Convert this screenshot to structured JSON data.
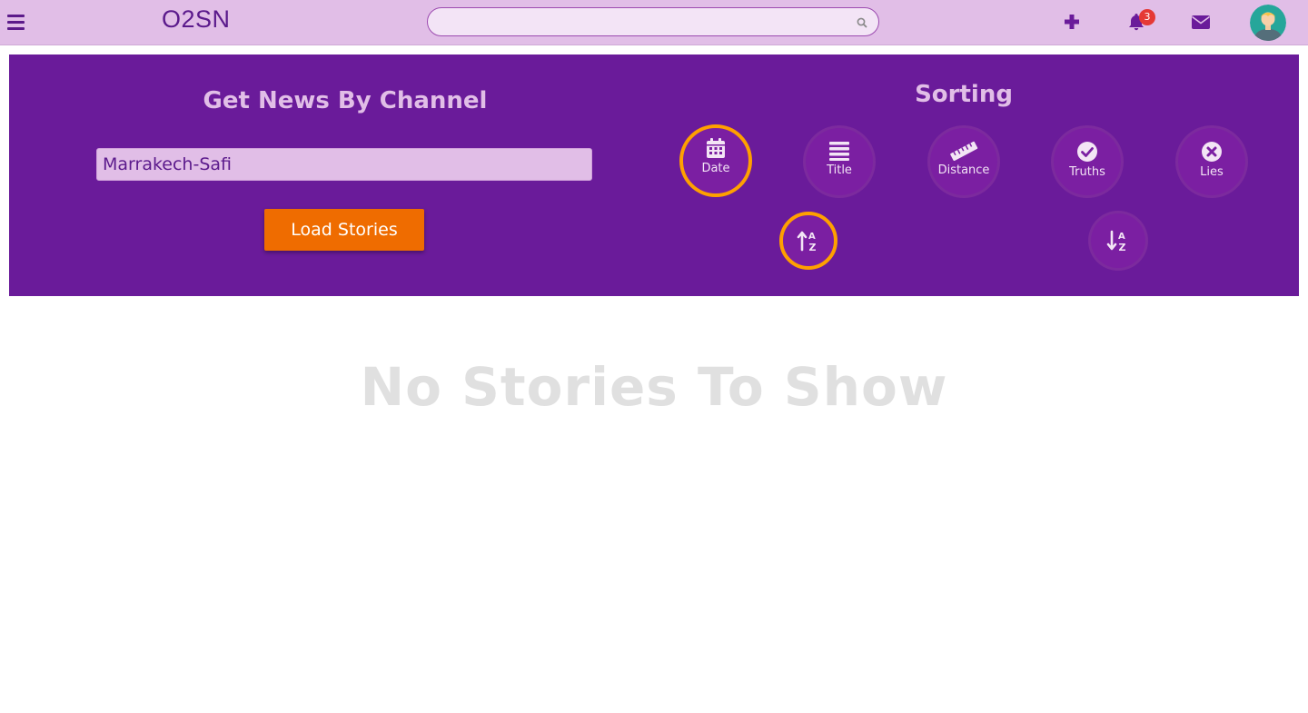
{
  "header": {
    "logo": "O2SN",
    "search": {
      "placeholder": "",
      "value": ""
    },
    "notifications_count": "3",
    "icons": [
      "menu-icon",
      "search-icon",
      "plus-icon",
      "bell-icon",
      "envelope-icon",
      "avatar"
    ]
  },
  "channel_panel": {
    "title": "Get News By Channel",
    "channel_value": "Marrakech-Safi",
    "load_button": "Load Stories"
  },
  "sorting": {
    "title": "Sorting",
    "options": [
      {
        "label": "Date",
        "icon": "calendar-icon",
        "active": true
      },
      {
        "label": "Title",
        "icon": "list-icon",
        "active": false
      },
      {
        "label": "Distance",
        "icon": "ruler-icon",
        "active": false
      },
      {
        "label": "Truths",
        "icon": "check-circle-icon",
        "active": false
      },
      {
        "label": "Lies",
        "icon": "times-circle-icon",
        "active": false
      }
    ],
    "order": [
      {
        "name": "ascending",
        "icon": "sort-alpha-up-icon",
        "active": true
      },
      {
        "name": "descending",
        "icon": "sort-alpha-down-icon",
        "active": false
      }
    ]
  },
  "main": {
    "empty_message": "No Stories To Show"
  },
  "colors": {
    "topbar": "#e1bee7",
    "panel": "#6a1b9a",
    "accent": "#ef6c00",
    "active_ring": "#ffa000",
    "brand": "#5b1a8c"
  }
}
